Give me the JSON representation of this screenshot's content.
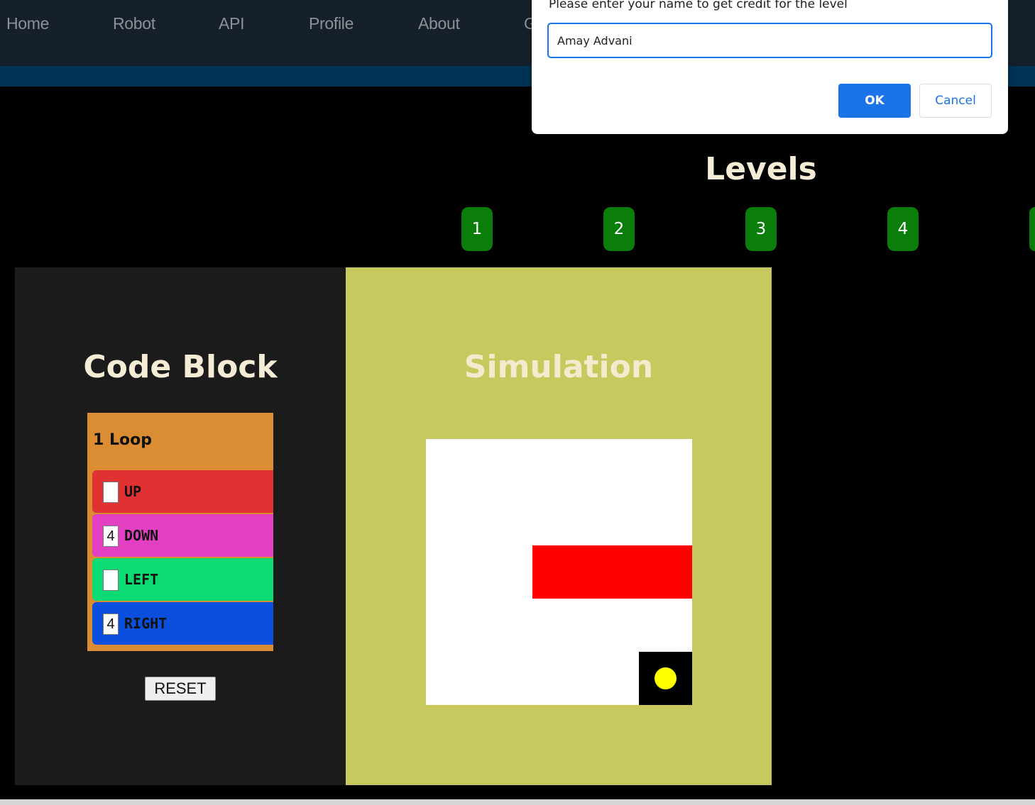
{
  "nav": {
    "links": [
      "Home",
      "Robot",
      "API",
      "Profile",
      "About",
      "G"
    ]
  },
  "levels": {
    "title": "Levels",
    "buttons": [
      "1",
      "2",
      "3",
      "4"
    ]
  },
  "code_block": {
    "title": "Code Block",
    "loop_label": "1 Loop",
    "commands": [
      {
        "value": "",
        "label": "UP",
        "color": "#e03232"
      },
      {
        "value": "4",
        "label": "DOWN",
        "color": "#e23fc2"
      },
      {
        "value": "",
        "label": "LEFT",
        "color": "#0cdb73"
      },
      {
        "value": "4",
        "label": "RIGHT",
        "color": "#0a4fdd"
      }
    ],
    "reset_label": "RESET"
  },
  "simulation": {
    "title": "Simulation"
  },
  "dialog": {
    "message": "Please enter your name to get credit for the level",
    "input_value": "Amay Advani",
    "ok_label": "OK",
    "cancel_label": "Cancel"
  },
  "colors": {
    "nav_background": "#15202b",
    "nav_stripe": "#003356",
    "level_button": "#0a7d0a",
    "loop_block": "#da8d32",
    "simulation_background": "#c7c95e",
    "wall": "#ff0000",
    "robot": "#ffff00",
    "dialog_accent": "#1a73e8"
  }
}
